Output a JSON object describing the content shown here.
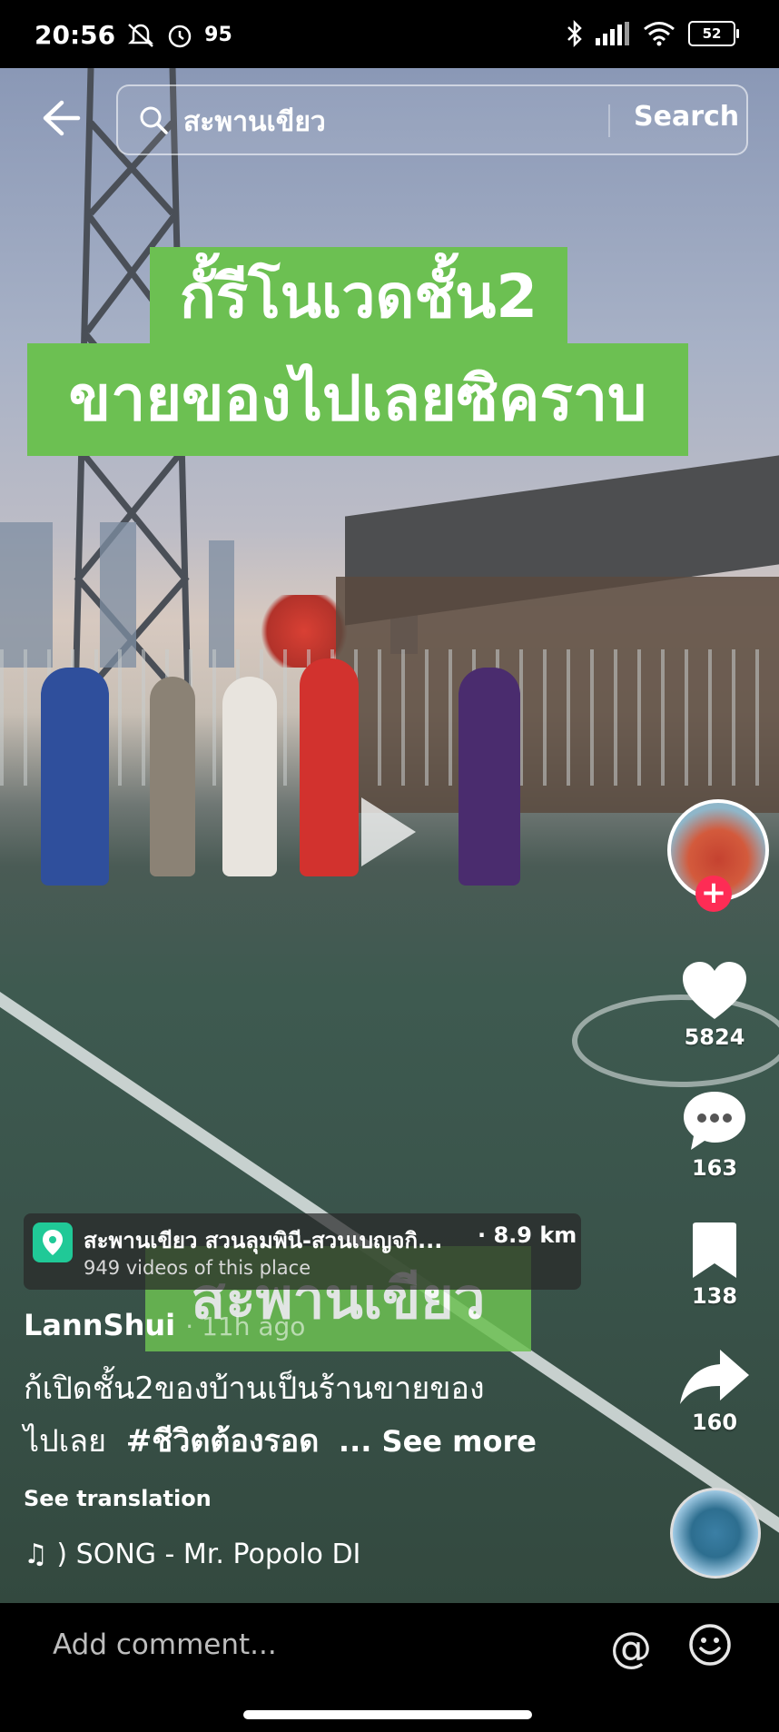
{
  "status_bar": {
    "time": "20:56",
    "alarm_count": "95",
    "battery": "52"
  },
  "search": {
    "query": "สะพานเขียว",
    "button": "Search"
  },
  "video": {
    "overlay_line1": "กั้รีโนเวดชั้น2",
    "overlay_line2": "ขายของไปเลยซิคราบ",
    "overlay_bottom": "สะพานเขียว"
  },
  "rail": {
    "likes": "5824",
    "comments": "163",
    "bookmarks": "138",
    "shares": "160"
  },
  "location": {
    "title": "สะพานเขียว สวนลุมพินี-สวนเบญจกิ...",
    "distance": "· 8.9 km",
    "subtitle": "949 videos of this place"
  },
  "post": {
    "author": "LannShui",
    "time": "· 11h ago",
    "caption_line1": "ก้เปิดชั้น2ของบ้านเป็นร้านขายของ",
    "caption_line2": "ไปเลย",
    "hashtag": "#ชีวิตต้องรอด",
    "see_more": "... See more",
    "see_translation": "See translation",
    "music": "♫ ) SONG - Mr. Popolo    DI"
  },
  "comment_bar": {
    "placeholder": "Add comment...",
    "at": "@"
  }
}
